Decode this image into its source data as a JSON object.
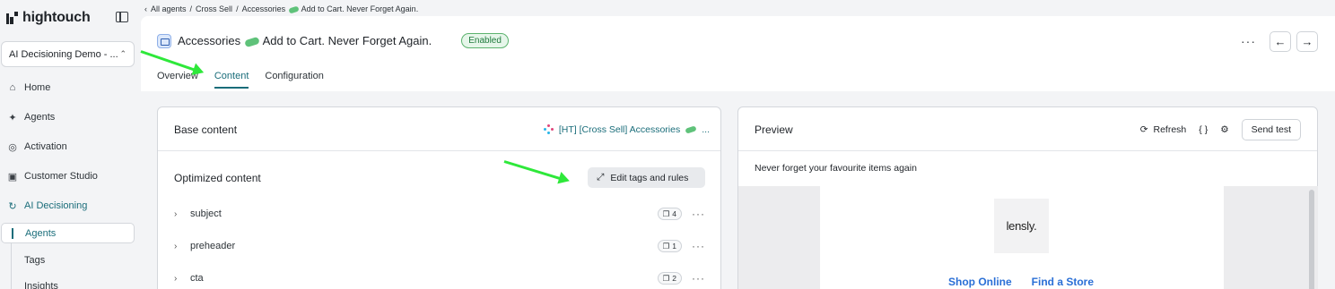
{
  "brand": {
    "name": "hightouch"
  },
  "sidebar": {
    "workspace": "AI Decisioning Demo - ...",
    "items": [
      {
        "label": "Home",
        "icon": "home-icon"
      },
      {
        "label": "Agents",
        "icon": "sparkle-icon"
      },
      {
        "label": "Activation",
        "icon": "activation-icon"
      },
      {
        "label": "Customer Studio",
        "icon": "studio-icon"
      },
      {
        "label": "AI Decisioning",
        "icon": "decisioning-icon"
      }
    ],
    "subitems": [
      {
        "label": "Agents"
      },
      {
        "label": "Tags"
      },
      {
        "label": "Insights"
      }
    ]
  },
  "breadcrumb": {
    "back": "‹",
    "items": [
      "All agents",
      "Cross Sell",
      "Accessories"
    ],
    "tail": "Add to Cart. Never Forget Again.",
    "separator": "/"
  },
  "header": {
    "title_start": "Accessories",
    "title_end": "Add to Cart. Never Forget Again.",
    "status": "Enabled",
    "more": "···",
    "prev": "←",
    "next": "→"
  },
  "tabs": [
    {
      "label": "Overview"
    },
    {
      "label": "Content"
    },
    {
      "label": "Configuration"
    }
  ],
  "base_content": {
    "title": "Base content",
    "source_start": "[HT] [Cross Sell] Accessories",
    "source_end": "..."
  },
  "optimized_content": {
    "title": "Optimized content",
    "edit_button": "Edit tags and rules",
    "rows": [
      {
        "label": "subject",
        "count": "4"
      },
      {
        "label": "preheader",
        "count": "1"
      },
      {
        "label": "cta",
        "count": "2"
      }
    ]
  },
  "preview": {
    "title": "Preview",
    "refresh": "Refresh",
    "code": "{ }",
    "send_test": "Send test",
    "subject": "Never forget your favourite items again",
    "logo": "lensly.",
    "links": [
      "Shop Online",
      "Find a Store"
    ]
  },
  "colors": {
    "accent": "#1a6d7a",
    "enabled_badge": "#1f7a3c",
    "annotation_arrow": "#2ee83a",
    "email_link": "#2a6fd6"
  }
}
